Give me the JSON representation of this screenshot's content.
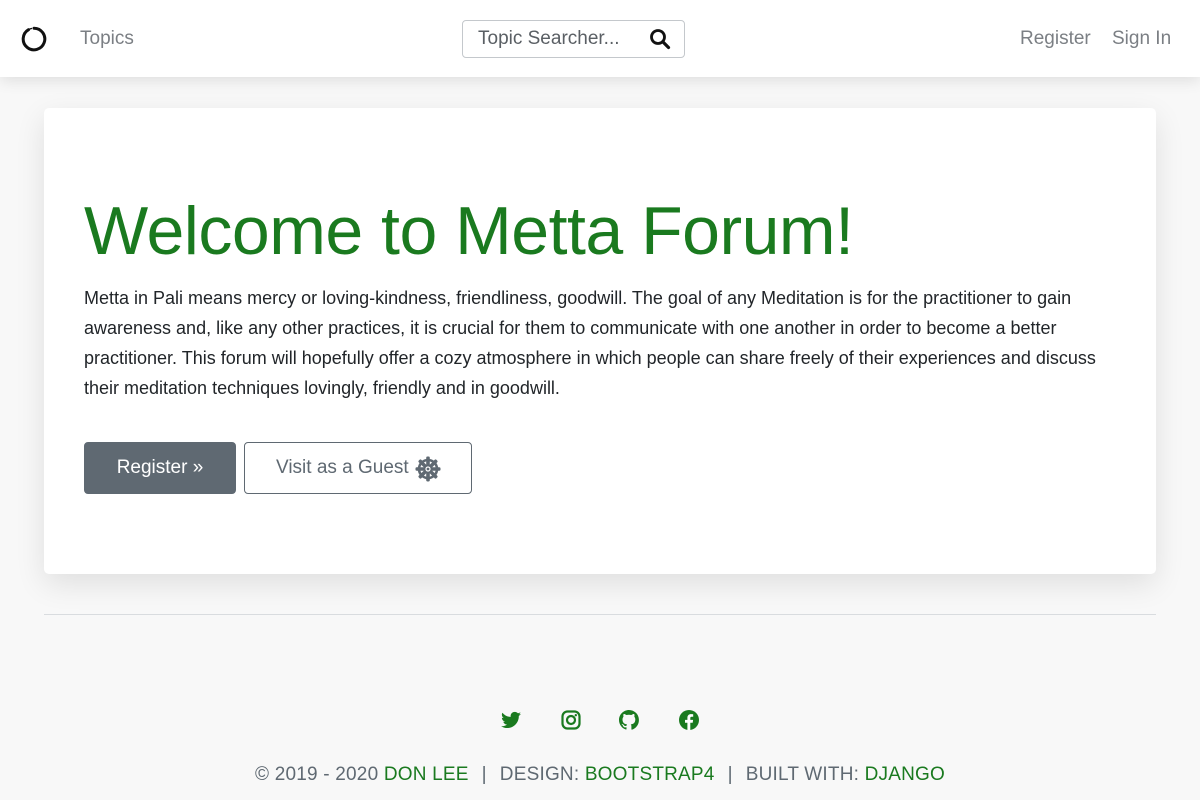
{
  "nav": {
    "topics": "Topics",
    "search_placeholder": "Topic Searcher...",
    "register": "Register",
    "sign_in": "Sign In"
  },
  "hero": {
    "title": "Welcome to Metta Forum!",
    "description": "Metta in Pali means mercy or loving-kindness, friendliness, goodwill. The goal of any Meditation is for the practitioner to gain awareness and, like any other practices, it is crucial for them to communicate with one another in order to become a better practitioner. This forum will hopefully offer a cozy atmosphere in which people can share freely of their experiences and discuss their meditation techniques lovingly, friendly and in goodwill.",
    "register_button": "Register »",
    "guest_button": "Visit as a Guest"
  },
  "footer": {
    "copyright": "© 2019 - 2020",
    "author": "DON LEE",
    "sep1": "|",
    "design_label": "DESIGN:",
    "design_value": "BOOTSTRAP4",
    "sep2": "|",
    "built_label": "BUILT WITH:",
    "built_value": "DJANGO"
  },
  "icons": {
    "brand": "circle-logo-icon",
    "search": "search-icon",
    "guest": "dharma-wheel-icon",
    "social": [
      "twitter-icon",
      "instagram-icon",
      "github-icon",
      "facebook-icon"
    ]
  },
  "colors": {
    "accent_green": "#1a7a1f",
    "button_gray": "#5f6972",
    "nav_text": "#7b7f84"
  }
}
